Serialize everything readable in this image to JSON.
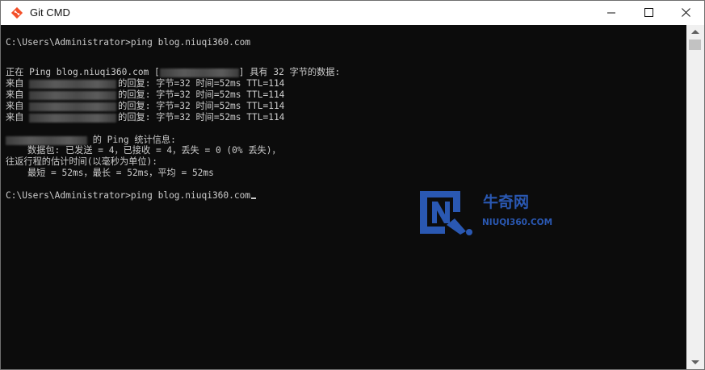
{
  "window": {
    "title": "Git CMD",
    "controls": {
      "minimize": "minimize-icon",
      "maximize": "maximize-icon",
      "close": "close-icon"
    }
  },
  "console": {
    "bg_color": "#0c0c0c",
    "text_color": "#cccccc",
    "lines": {
      "cmd1": "C:\\Users\\Administrator>ping blog.niuqi360.com",
      "ping_header_pre": "正在 Ping blog.niuqi360.com [",
      "ping_header_post": "] 具有 32 字节的数据:",
      "reply_prefix": "来自 ",
      "replies": [
        "的回复: 字节=32 时间=52ms TTL=114",
        "的回复: 字节=32 时间=52ms TTL=114",
        "的回复: 字节=32 时间=52ms TTL=114",
        "的回复: 字节=32 时间=52ms TTL=114"
      ],
      "stats_title": " 的 Ping 统计信息:",
      "stats_packets": "    数据包: 已发送 = 4，已接收 = 4，丢失 = 0 (0% 丢失)，",
      "rtt_title": "往返行程的估计时间(以毫秒为单位):",
      "rtt_values": "    最短 = 52ms，最长 = 52ms，平均 = 52ms",
      "cmd2": "C:\\Users\\Administrator>ping blog.niuqi360.com"
    }
  },
  "watermark": {
    "cn": "牛奇网",
    "en": "NIUQI360.COM",
    "color": "#2a58b2"
  }
}
